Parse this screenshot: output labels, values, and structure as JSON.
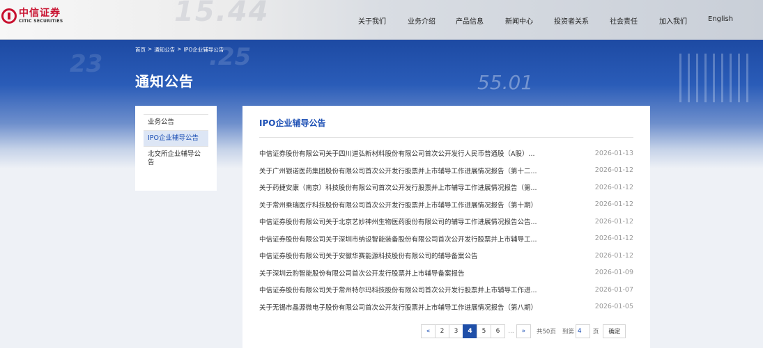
{
  "logo": {
    "cn": "中信证券",
    "en": "CITIC SECURITIES"
  },
  "nav": [
    "关于我们",
    "业务介绍",
    "产品信息",
    "新闻中心",
    "投资者关系",
    "社会责任",
    "加入我们",
    "English"
  ],
  "breadcrumb": {
    "home": "首页",
    "sep": ">",
    "level1": "通知公告",
    "level2": "IPO企业辅导公告"
  },
  "page_title": "通知公告",
  "sidebar": {
    "items": [
      "业务公告",
      "IPO企业辅导公告",
      "北交所企业辅导公告"
    ]
  },
  "main": {
    "title": "IPO企业辅导公告",
    "rows": [
      {
        "title": "中信证券股份有限公司关于四川道弘新材料股份有限公司首次公开发行人民币普通股（A股）...",
        "date": "2026-01-13"
      },
      {
        "title": "关于广州银诺医药集团股份有限公司首次公开发行股票并上市辅导工作进展情况报告（第十二...",
        "date": "2026-01-12"
      },
      {
        "title": "关于药捷安康（南京）科技股份有限公司首次公开发行股票并上市辅导工作进展情况报告（第...",
        "date": "2026-01-12"
      },
      {
        "title": "关于常州乘瑞医疗科技股份有限公司首次公开发行股票并上市辅导工作进展情况报告（第十期）",
        "date": "2026-01-12"
      },
      {
        "title": "中信证券股份有限公司关于北京艺妙神州生物医药股份有限公司的辅导工作进展情况报告公告...",
        "date": "2026-01-12"
      },
      {
        "title": "中信证券股份有限公司关于深圳市纳设智能装备股份有限公司首次公开发行股票并上市辅导工...",
        "date": "2026-01-12"
      },
      {
        "title": "中信证券股份有限公司关于安徽华赛能源科技股份有限公司的辅导备案公告",
        "date": "2026-01-12"
      },
      {
        "title": "关于深圳云豹智能股份有限公司首次公开发行股票并上市辅导备案报告",
        "date": "2026-01-09"
      },
      {
        "title": "中信证券股份有限公司关于常州特尔玛科技股份有限公司首次公开发行股票并上市辅导工作进...",
        "date": "2026-01-07"
      },
      {
        "title": "关于无锡市晶源微电子股份有限公司首次公开发行股票并上市辅导工作进展情况报告（第八期）",
        "date": "2026-01-05"
      }
    ]
  },
  "pager": {
    "prev": "«",
    "pages": [
      "2",
      "3",
      "4",
      "5",
      "6"
    ],
    "current": "4",
    "gap": "...",
    "next": "»",
    "total": "共50页",
    "goto_label": "到第",
    "goto_value": "4",
    "unit": "页",
    "confirm": "确定"
  }
}
